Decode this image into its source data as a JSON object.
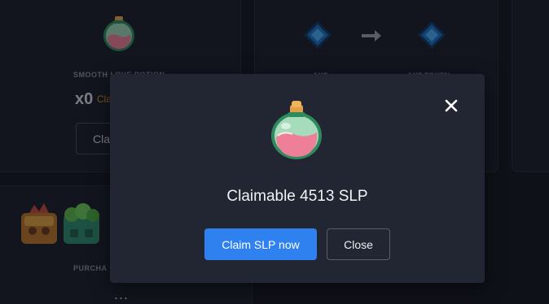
{
  "background": {
    "potion_card": {
      "name": "SMOOTH LOVE POTION",
      "count": "x0",
      "claim_text": "Cla",
      "button_label": "Cla"
    },
    "axs_card": {
      "left_label": "AXS",
      "right_label": "AXS TOKEN"
    },
    "purchase_card": {
      "label": "PURCHA",
      "more": "..."
    }
  },
  "modal": {
    "title": "Claimable 4513 SLP",
    "primary_button": "Claim SLP now",
    "secondary_button": "Close"
  },
  "colors": {
    "accent": "#2f81f0",
    "modal_bg": "#222633",
    "page_bg": "#141722",
    "claim_orange": "#d89a3a"
  }
}
